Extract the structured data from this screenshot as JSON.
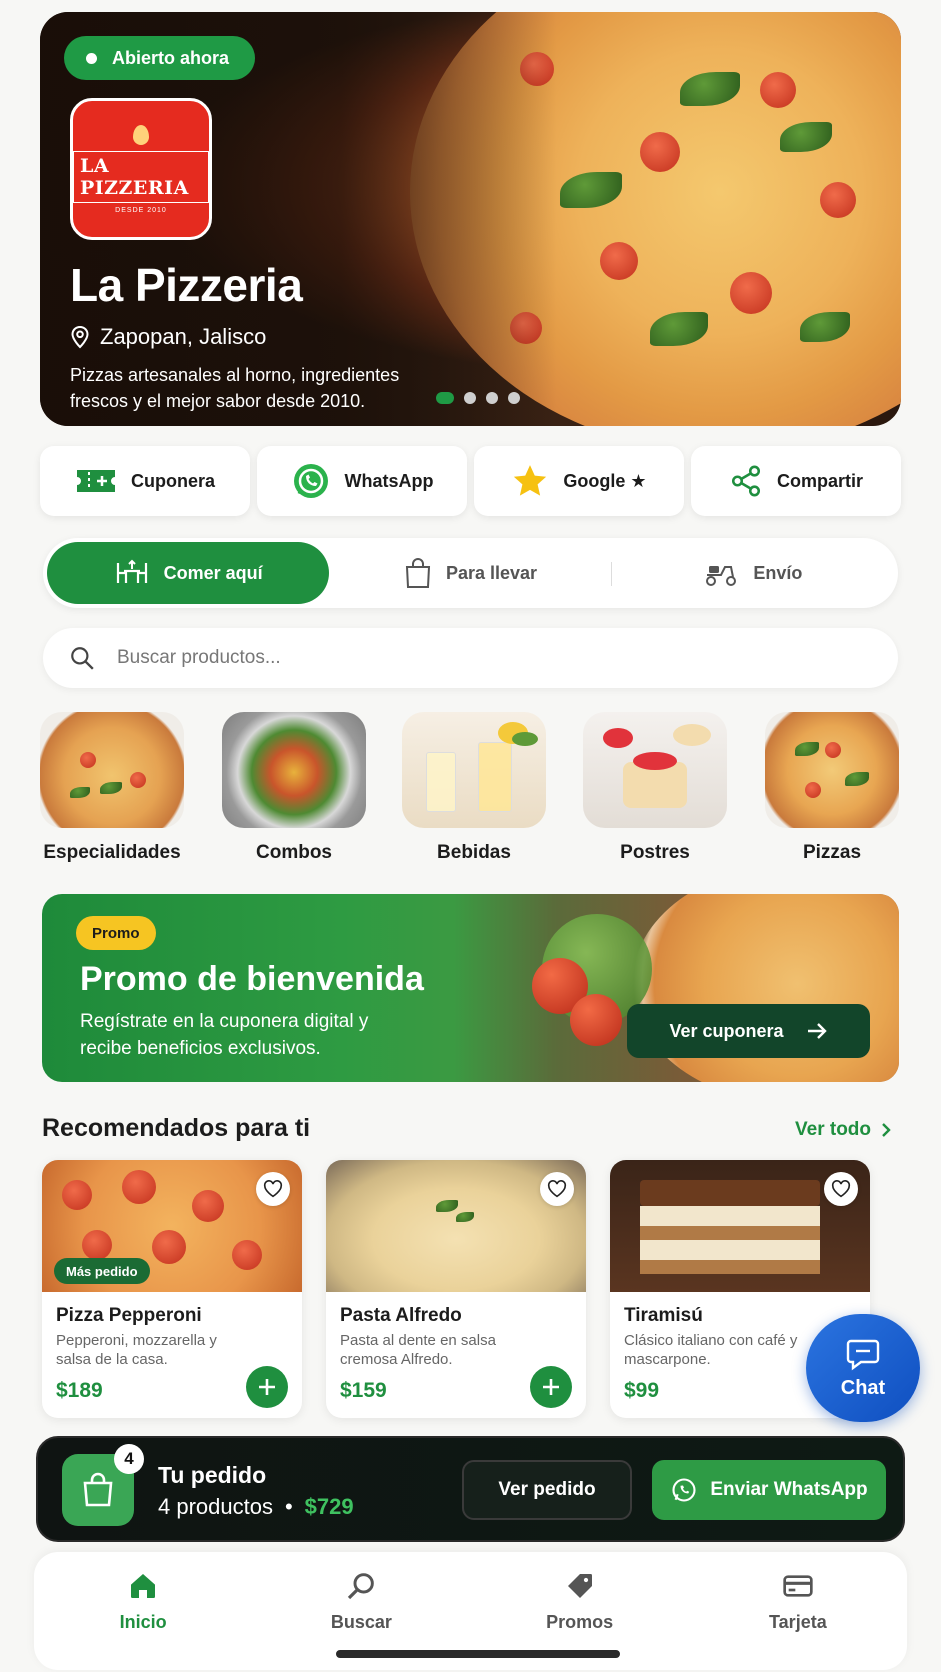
{
  "hero": {
    "status_badge": "Abierto ahora",
    "logo_text": "LA PIZZERIA",
    "logo_sub": "DESDE 2010",
    "title": "La Pizzeria",
    "location": "Zapopan, Jalisco",
    "description": "Pizzas artesanales al horno, ingredientes frescos y el mejor sabor desde 2010.",
    "carousel": {
      "total": 4,
      "active": 1
    }
  },
  "quick_actions": [
    {
      "label": "Cuponera",
      "icon": "ticket-icon"
    },
    {
      "label": "WhatsApp",
      "icon": "whatsapp-icon"
    },
    {
      "label": "Google ★",
      "icon": "star-icon"
    },
    {
      "label": "Compartir",
      "icon": "share-icon"
    }
  ],
  "modes": [
    {
      "label": "Comer aquí",
      "icon": "dine-in-icon",
      "active": true
    },
    {
      "label": "Para llevar",
      "icon": "bag-icon",
      "active": false
    },
    {
      "label": "Envío",
      "icon": "scooter-icon",
      "active": false
    }
  ],
  "search": {
    "placeholder": "Buscar productos..."
  },
  "categories": [
    {
      "label": "Especialidades"
    },
    {
      "label": "Combos"
    },
    {
      "label": "Bebidas"
    },
    {
      "label": "Postres"
    },
    {
      "label": "Pizzas"
    }
  ],
  "promo": {
    "badge": "Promo",
    "title": "Promo de bienvenida",
    "description": "Regístrate en la cuponera digital y recibe beneficios exclusivos.",
    "button": "Ver cuponera"
  },
  "recommended": {
    "title": "Recomendados para ti",
    "see_all": "Ver todo",
    "items": [
      {
        "name": "Pizza Pepperoni",
        "description": "Pepperoni, mozzarella y salsa de la casa.",
        "price": "$189",
        "badge": "Más pedido"
      },
      {
        "name": "Pasta Alfredo",
        "description": "Pasta al dente en salsa cremosa Alfredo.",
        "price": "$159",
        "badge": ""
      },
      {
        "name": "Tiramisú",
        "description": "Clásico italiano con café y mascarpone.",
        "price": "$99",
        "badge": ""
      }
    ]
  },
  "chat": {
    "label": "Chat"
  },
  "order": {
    "count": "4",
    "title": "Tu pedido",
    "items_text": "4 productos",
    "separator": "•",
    "total": "$729",
    "view_button": "Ver pedido",
    "whatsapp_button": "Enviar WhatsApp"
  },
  "nav": [
    {
      "label": "Inicio",
      "icon": "home-icon",
      "active": true
    },
    {
      "label": "Buscar",
      "icon": "search-icon",
      "active": false
    },
    {
      "label": "Promos",
      "icon": "tag-icon",
      "active": false
    },
    {
      "label": "Tarjeta",
      "icon": "card-icon",
      "active": false
    }
  ],
  "colors": {
    "primary": "#1f8f3f",
    "accent_yellow": "#f6c522",
    "chat_blue": "#1f5fd0",
    "dark": "#0f1412"
  }
}
